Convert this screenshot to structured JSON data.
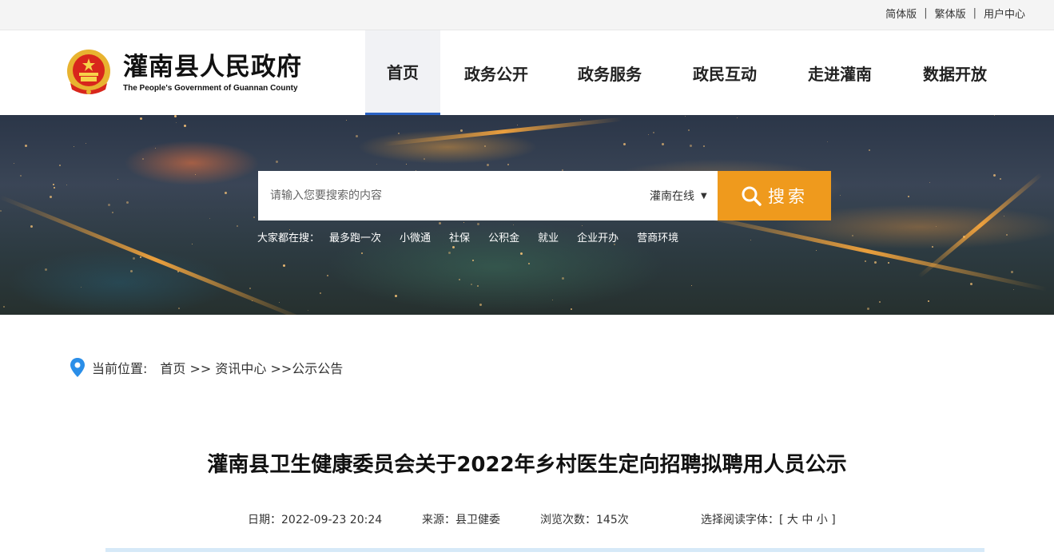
{
  "topbar": {
    "simplified": "简体版",
    "traditional": "繁体版",
    "user_center": "用户中心",
    "separator": "|"
  },
  "logo": {
    "title_cn": "灌南县人民政府",
    "title_en": "The People's Government of Guannan County",
    "emblem_icon": "national-emblem-icon"
  },
  "nav": {
    "items": [
      {
        "label": "首页",
        "active": true
      },
      {
        "label": "政务公开"
      },
      {
        "label": "政务服务"
      },
      {
        "label": "政民互动"
      },
      {
        "label": "走进灌南"
      },
      {
        "label": "数据开放"
      }
    ]
  },
  "search": {
    "placeholder": "请输入您要搜索的内容",
    "scope": "灌南在线",
    "button_label": "搜索",
    "hot_lead": "大家都在搜：",
    "hot_items": [
      "最多跑一次",
      "小微通",
      "社保",
      "公积金",
      "就业",
      "企业开办",
      "营商环境"
    ]
  },
  "breadcrumb": {
    "label": "当前位置:",
    "path": "首页 >> 资讯中心 >>公示公告"
  },
  "article": {
    "title": "灌南县卫生健康委员会关于2022年乡村医生定向招聘拟聘用人员公示",
    "date": "日期：2022-09-23 20:24",
    "source": "来源：县卫健委",
    "views": "浏览次数：145次",
    "font_size": "选择阅读字体：[ 大 中 小 ]"
  },
  "colors": {
    "accent": "#2b63c5",
    "search_button": "#ef9a1d",
    "divider": "#d6e9f8"
  }
}
